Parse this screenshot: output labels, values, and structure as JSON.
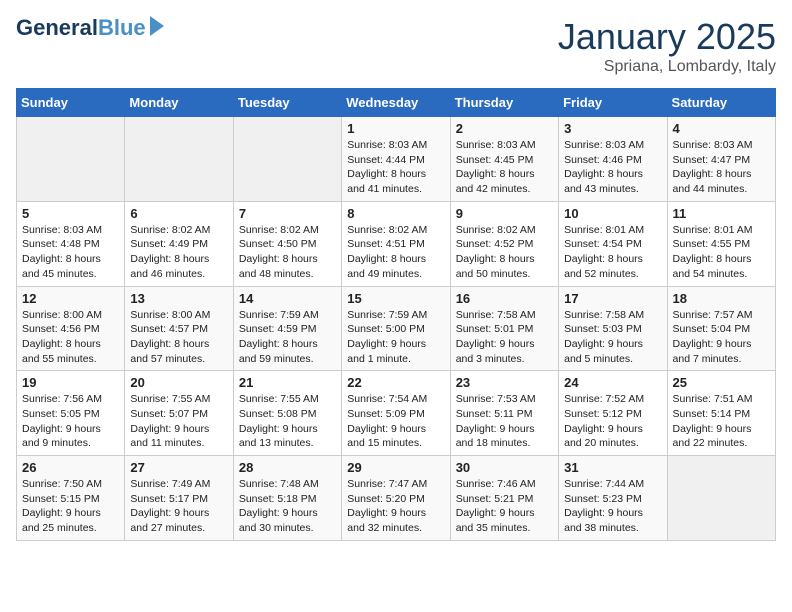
{
  "header": {
    "logo_line1": "General",
    "logo_line2": "Blue",
    "month": "January 2025",
    "location": "Spriana, Lombardy, Italy"
  },
  "days_of_week": [
    "Sunday",
    "Monday",
    "Tuesday",
    "Wednesday",
    "Thursday",
    "Friday",
    "Saturday"
  ],
  "weeks": [
    [
      {
        "day": "",
        "empty": true
      },
      {
        "day": "",
        "empty": true
      },
      {
        "day": "",
        "empty": true
      },
      {
        "day": "1",
        "sunrise": "8:03 AM",
        "sunset": "4:44 PM",
        "daylight": "8 hours and 41 minutes."
      },
      {
        "day": "2",
        "sunrise": "8:03 AM",
        "sunset": "4:45 PM",
        "daylight": "8 hours and 42 minutes."
      },
      {
        "day": "3",
        "sunrise": "8:03 AM",
        "sunset": "4:46 PM",
        "daylight": "8 hours and 43 minutes."
      },
      {
        "day": "4",
        "sunrise": "8:03 AM",
        "sunset": "4:47 PM",
        "daylight": "8 hours and 44 minutes."
      }
    ],
    [
      {
        "day": "5",
        "sunrise": "8:03 AM",
        "sunset": "4:48 PM",
        "daylight": "8 hours and 45 minutes."
      },
      {
        "day": "6",
        "sunrise": "8:02 AM",
        "sunset": "4:49 PM",
        "daylight": "8 hours and 46 minutes."
      },
      {
        "day": "7",
        "sunrise": "8:02 AM",
        "sunset": "4:50 PM",
        "daylight": "8 hours and 48 minutes."
      },
      {
        "day": "8",
        "sunrise": "8:02 AM",
        "sunset": "4:51 PM",
        "daylight": "8 hours and 49 minutes."
      },
      {
        "day": "9",
        "sunrise": "8:02 AM",
        "sunset": "4:52 PM",
        "daylight": "8 hours and 50 minutes."
      },
      {
        "day": "10",
        "sunrise": "8:01 AM",
        "sunset": "4:54 PM",
        "daylight": "8 hours and 52 minutes."
      },
      {
        "day": "11",
        "sunrise": "8:01 AM",
        "sunset": "4:55 PM",
        "daylight": "8 hours and 54 minutes."
      }
    ],
    [
      {
        "day": "12",
        "sunrise": "8:00 AM",
        "sunset": "4:56 PM",
        "daylight": "8 hours and 55 minutes."
      },
      {
        "day": "13",
        "sunrise": "8:00 AM",
        "sunset": "4:57 PM",
        "daylight": "8 hours and 57 minutes."
      },
      {
        "day": "14",
        "sunrise": "7:59 AM",
        "sunset": "4:59 PM",
        "daylight": "8 hours and 59 minutes."
      },
      {
        "day": "15",
        "sunrise": "7:59 AM",
        "sunset": "5:00 PM",
        "daylight": "9 hours and 1 minute."
      },
      {
        "day": "16",
        "sunrise": "7:58 AM",
        "sunset": "5:01 PM",
        "daylight": "9 hours and 3 minutes."
      },
      {
        "day": "17",
        "sunrise": "7:58 AM",
        "sunset": "5:03 PM",
        "daylight": "9 hours and 5 minutes."
      },
      {
        "day": "18",
        "sunrise": "7:57 AM",
        "sunset": "5:04 PM",
        "daylight": "9 hours and 7 minutes."
      }
    ],
    [
      {
        "day": "19",
        "sunrise": "7:56 AM",
        "sunset": "5:05 PM",
        "daylight": "9 hours and 9 minutes."
      },
      {
        "day": "20",
        "sunrise": "7:55 AM",
        "sunset": "5:07 PM",
        "daylight": "9 hours and 11 minutes."
      },
      {
        "day": "21",
        "sunrise": "7:55 AM",
        "sunset": "5:08 PM",
        "daylight": "9 hours and 13 minutes."
      },
      {
        "day": "22",
        "sunrise": "7:54 AM",
        "sunset": "5:09 PM",
        "daylight": "9 hours and 15 minutes."
      },
      {
        "day": "23",
        "sunrise": "7:53 AM",
        "sunset": "5:11 PM",
        "daylight": "9 hours and 18 minutes."
      },
      {
        "day": "24",
        "sunrise": "7:52 AM",
        "sunset": "5:12 PM",
        "daylight": "9 hours and 20 minutes."
      },
      {
        "day": "25",
        "sunrise": "7:51 AM",
        "sunset": "5:14 PM",
        "daylight": "9 hours and 22 minutes."
      }
    ],
    [
      {
        "day": "26",
        "sunrise": "7:50 AM",
        "sunset": "5:15 PM",
        "daylight": "9 hours and 25 minutes."
      },
      {
        "day": "27",
        "sunrise": "7:49 AM",
        "sunset": "5:17 PM",
        "daylight": "9 hours and 27 minutes."
      },
      {
        "day": "28",
        "sunrise": "7:48 AM",
        "sunset": "5:18 PM",
        "daylight": "9 hours and 30 minutes."
      },
      {
        "day": "29",
        "sunrise": "7:47 AM",
        "sunset": "5:20 PM",
        "daylight": "9 hours and 32 minutes."
      },
      {
        "day": "30",
        "sunrise": "7:46 AM",
        "sunset": "5:21 PM",
        "daylight": "9 hours and 35 minutes."
      },
      {
        "day": "31",
        "sunrise": "7:44 AM",
        "sunset": "5:23 PM",
        "daylight": "9 hours and 38 minutes."
      },
      {
        "day": "",
        "empty": true
      }
    ]
  ]
}
